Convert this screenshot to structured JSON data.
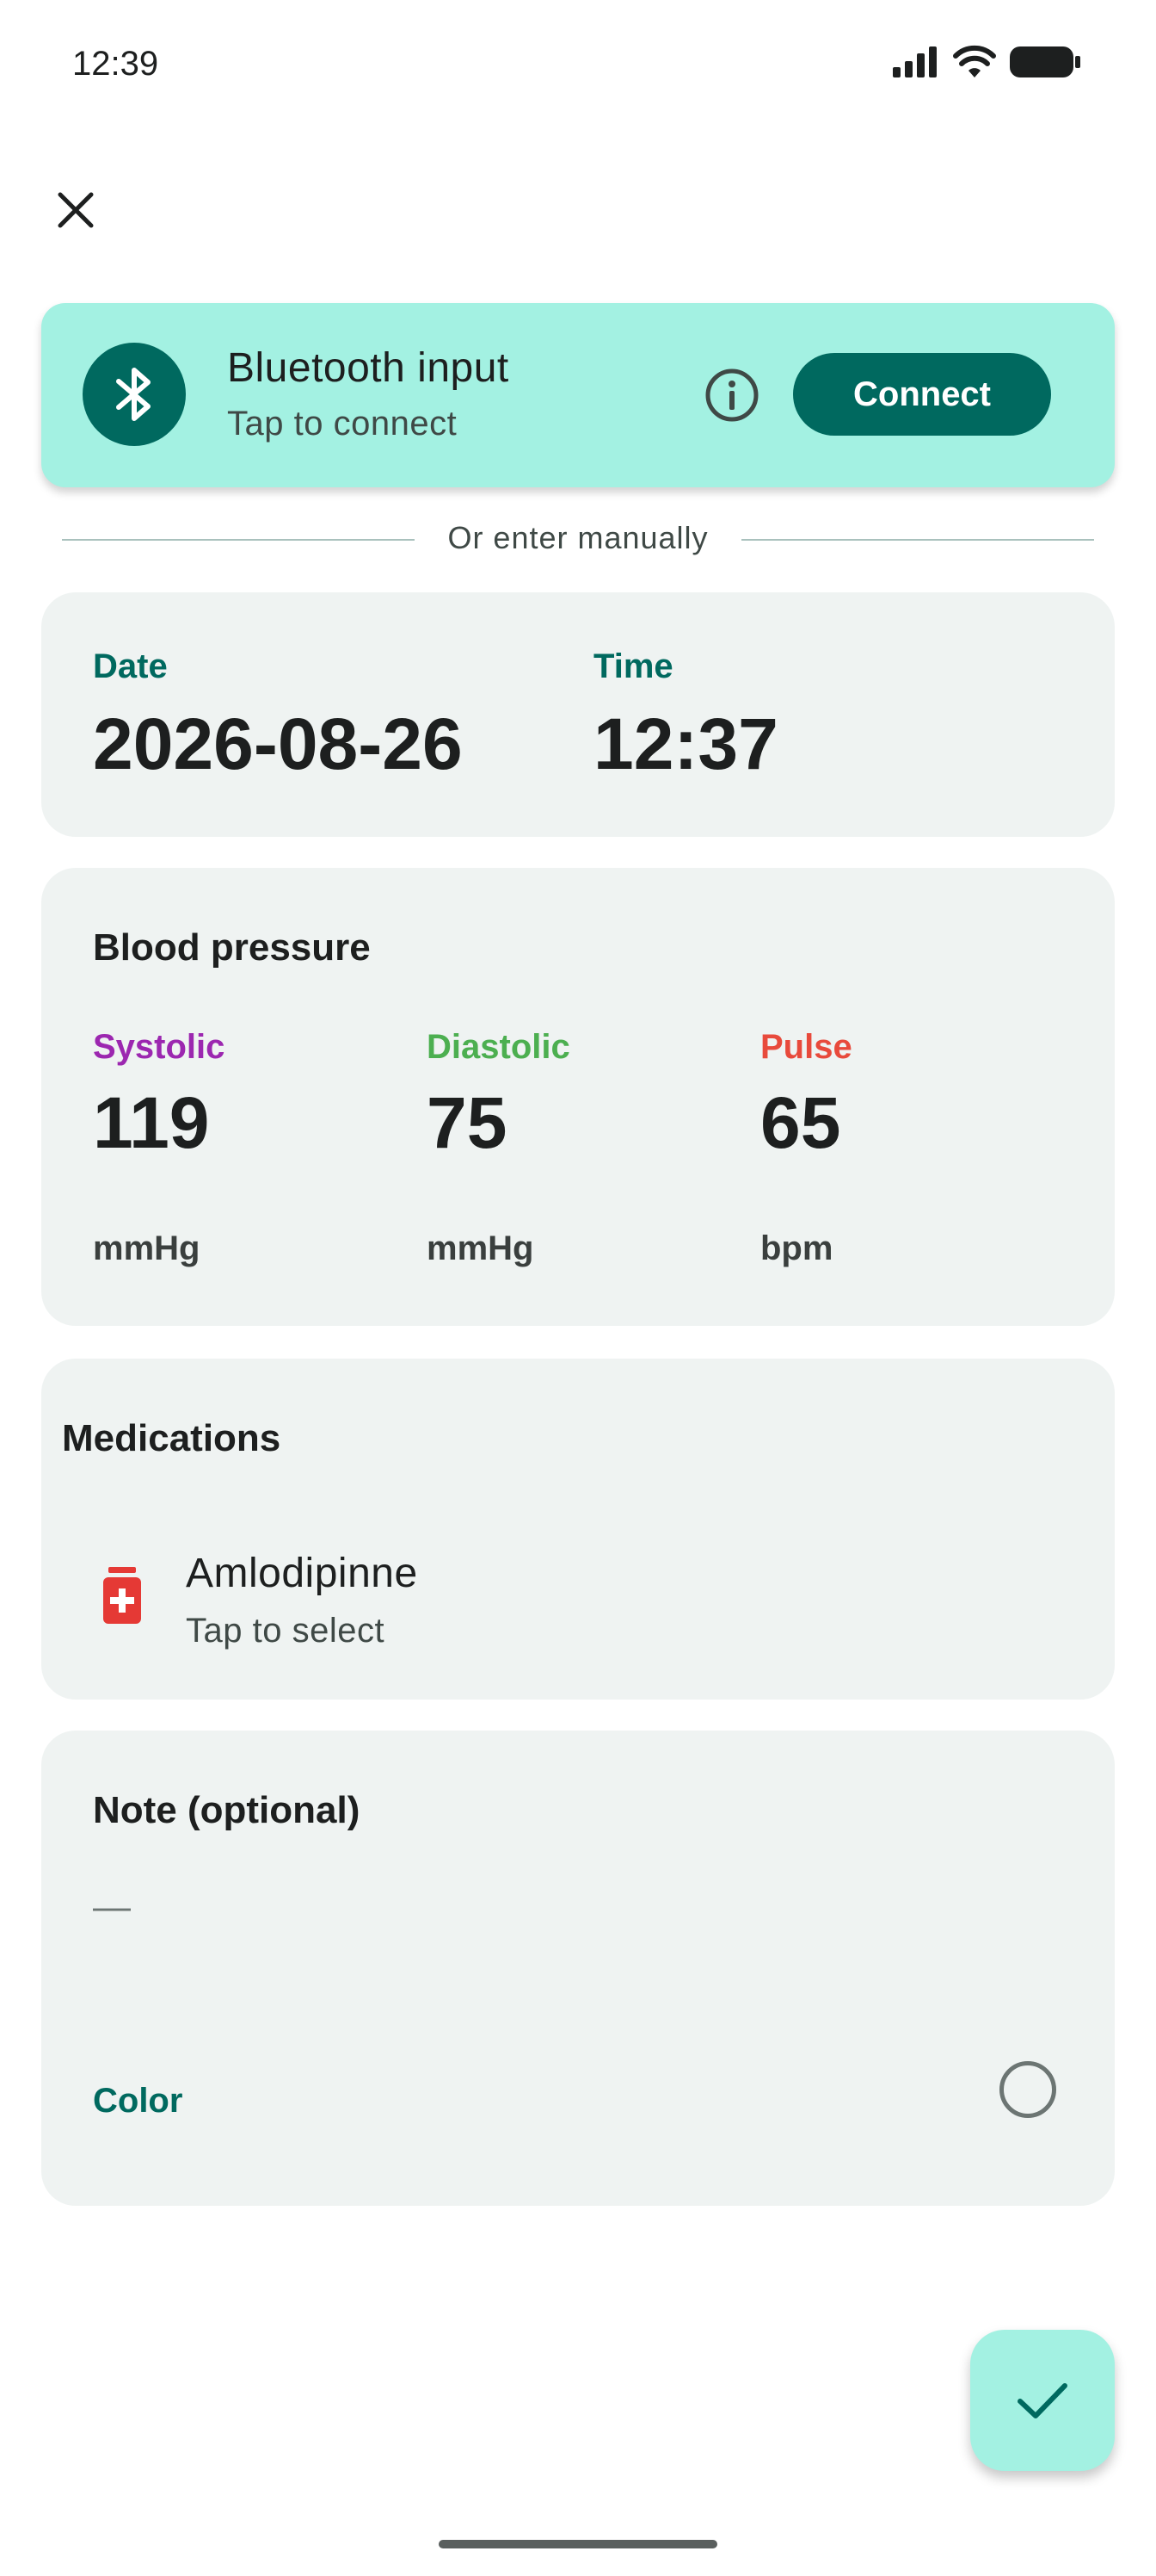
{
  "status_bar": {
    "time": "12:39"
  },
  "bluetooth": {
    "title": "Bluetooth input",
    "subtitle": "Tap to connect",
    "connect_label": "Connect"
  },
  "divider_text": "Or enter manually",
  "datetime": {
    "date_label": "Date",
    "date_value": "2026-08-26",
    "time_label": "Time",
    "time_value": "12:37"
  },
  "blood_pressure": {
    "title": "Blood pressure",
    "systolic": {
      "label": "Systolic",
      "value": "119",
      "unit": "mmHg",
      "color": "#9c27b0"
    },
    "diastolic": {
      "label": "Diastolic",
      "value": "75",
      "unit": "mmHg",
      "color": "#4caf50"
    },
    "pulse": {
      "label": "Pulse",
      "value": "65",
      "unit": "bpm",
      "color": "#e84a3c"
    }
  },
  "medications": {
    "title": "Medications",
    "items": [
      {
        "name": "Amlodipinne",
        "subtitle": "Tap to select",
        "icon": "medication-bottle-icon",
        "icon_color": "#e53935"
      }
    ]
  },
  "note": {
    "title": "Note (optional)",
    "placeholder": "—",
    "color_label": "Color"
  },
  "colors": {
    "accent": "#00695f",
    "card": "#eff3f2",
    "banner": "#a3f1e2"
  },
  "icons": {
    "close": "close-icon",
    "bluetooth": "bluetooth-icon",
    "info": "info-icon",
    "save": "check-icon"
  }
}
